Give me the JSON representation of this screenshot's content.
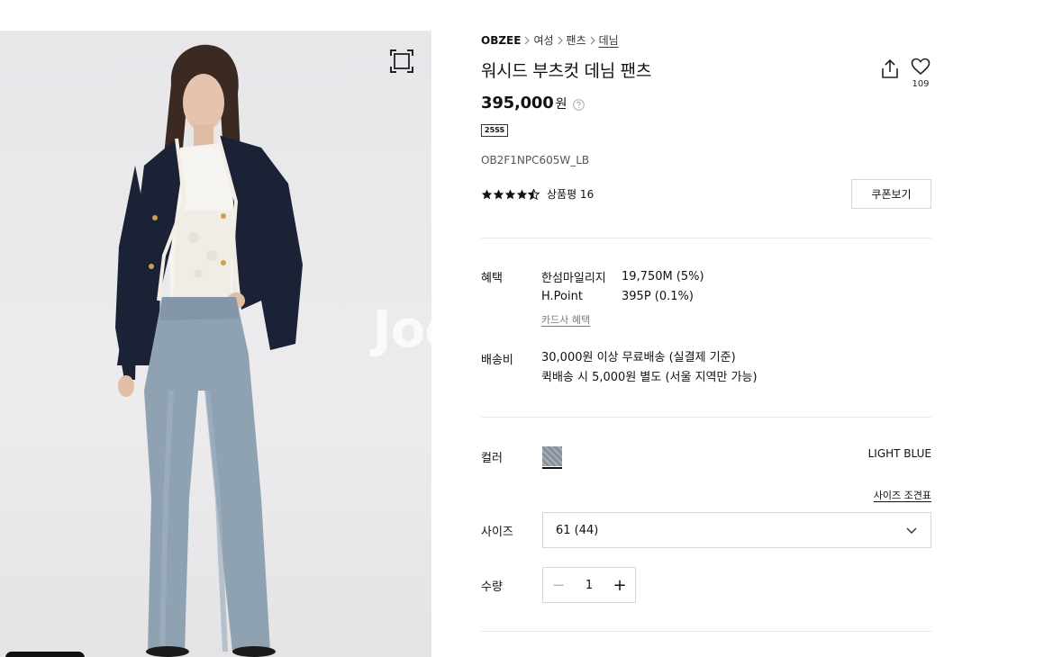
{
  "gallery": {
    "watermark": "Joo",
    "zoom_icon": "expand-frame-icon"
  },
  "breadcrumb": {
    "brand": "OBZEE",
    "items": [
      "여성",
      "팬츠",
      "데님"
    ],
    "separator_icon": "chevron-right-icon"
  },
  "product": {
    "title": "워시드 부츠컷 데님 팬츠",
    "price": "395,000",
    "currency": "원",
    "season_badge": "25SS",
    "sku": "OB2F1NPC605W_LB",
    "rating": 4.5,
    "review_label": "상품평 16",
    "like_count": "109"
  },
  "actions": {
    "share_icon": "share-icon",
    "like_icon": "heart-icon",
    "coupon_label": "쿠폰보기",
    "price_help_icon": "question-circle-icon"
  },
  "benefits": {
    "label": "혜택",
    "items": [
      {
        "name": "한섬마일리지",
        "value": "19,750M (5%)"
      },
      {
        "name": "H.Point",
        "value": "395P (0.1%)"
      }
    ],
    "card_link": "카드사 혜택"
  },
  "shipping": {
    "label": "배송비",
    "lines": [
      "30,000원 이상 무료배송 (실결제 기준)",
      "퀵배송 시 5,000원 별도 (서울 지역만 가능)"
    ]
  },
  "options": {
    "color_label": "컬러",
    "color_name": "LIGHT BLUE",
    "size_guide": "사이즈 조견표",
    "size_label": "사이즈",
    "size_selected": "61 (44)",
    "quantity_label": "수량",
    "quantity": "1",
    "minus": "−",
    "plus": "+"
  },
  "colors": {
    "text": "#111111",
    "border": "#d6d6d6",
    "divider": "#e8e8e8",
    "muted": "#777777"
  }
}
